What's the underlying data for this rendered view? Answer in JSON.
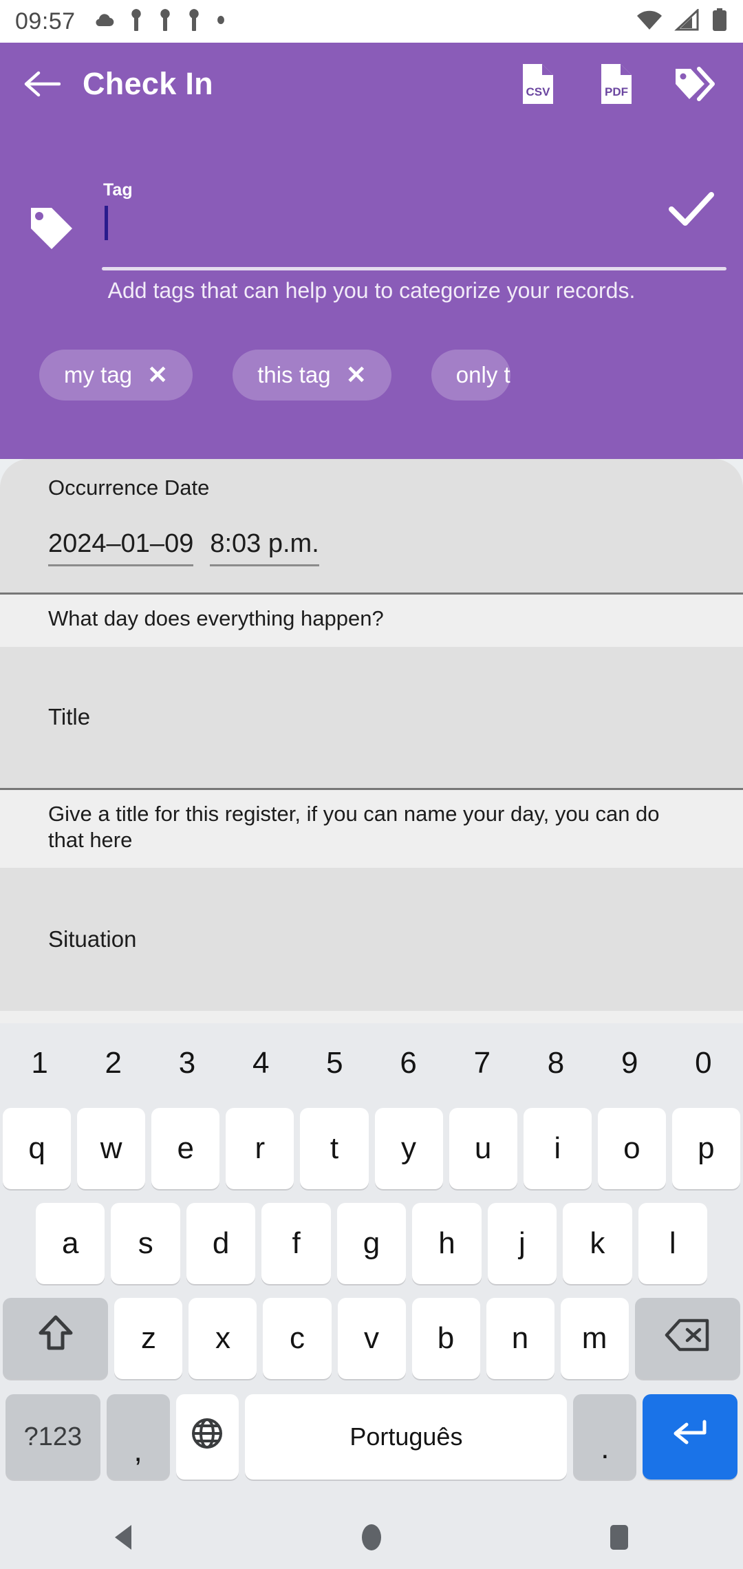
{
  "status_bar": {
    "time": "09:57",
    "left_icons": [
      "cloud-icon",
      "notification-icon",
      "notification-icon",
      "notification-icon",
      "dot-icon"
    ],
    "right_icons": [
      "wifi-icon",
      "cellular-signal-icon",
      "battery-icon"
    ]
  },
  "app_bar": {
    "back_label": "back-arrow",
    "title": "Check In",
    "actions": [
      {
        "name": "export-csv",
        "label": "CSV"
      },
      {
        "name": "export-pdf",
        "label": "PDF"
      },
      {
        "name": "tags",
        "label": "tags"
      }
    ]
  },
  "tag_panel": {
    "field_label": "Tag",
    "field_value": "",
    "field_placeholder": "",
    "helper": "Add tags that can help you to categorize your records.",
    "confirm_label": "confirm",
    "chips": [
      {
        "label": "my tag",
        "remove": "✕"
      },
      {
        "label": "this tag",
        "remove": "✕"
      },
      {
        "label": "only t",
        "remove": "✕"
      }
    ]
  },
  "form": {
    "occurrence": {
      "label": "Occurrence Date",
      "date": "2024–01–09",
      "time": "8:03 p.m.",
      "helper": "What day does everything happen?"
    },
    "title": {
      "placeholder": "Title",
      "value": "",
      "helper": "Give a title for this register, if you can name your day, you can do that here"
    },
    "situation": {
      "placeholder": "Situation",
      "value": ""
    }
  },
  "keyboard": {
    "numbers": [
      "1",
      "2",
      "3",
      "4",
      "5",
      "6",
      "7",
      "8",
      "9",
      "0"
    ],
    "row1": [
      "q",
      "w",
      "e",
      "r",
      "t",
      "y",
      "u",
      "i",
      "o",
      "p"
    ],
    "row2": [
      "a",
      "s",
      "d",
      "f",
      "g",
      "h",
      "j",
      "k",
      "l"
    ],
    "row3": [
      "z",
      "x",
      "c",
      "v",
      "b",
      "n",
      "m"
    ],
    "shift_label": "shift-icon",
    "backspace_label": "backspace-icon",
    "symbols_label": "?123",
    "comma_label": ",",
    "globe_label": "globe-icon",
    "space_label": "Português",
    "period_label": ".",
    "enter_label": "enter-icon"
  },
  "nav_bar": {
    "back": "back-triangle",
    "home": "home-circle",
    "recents": "recents-square"
  },
  "colors": {
    "primary_purple": "#8a5cb8",
    "sheet_bg": "#efefef",
    "field_bg": "#e0e0e0",
    "keyboard_bg": "#e8eaed",
    "enter_blue": "#1a73e8",
    "caret_blue": "#2a1b8c"
  }
}
